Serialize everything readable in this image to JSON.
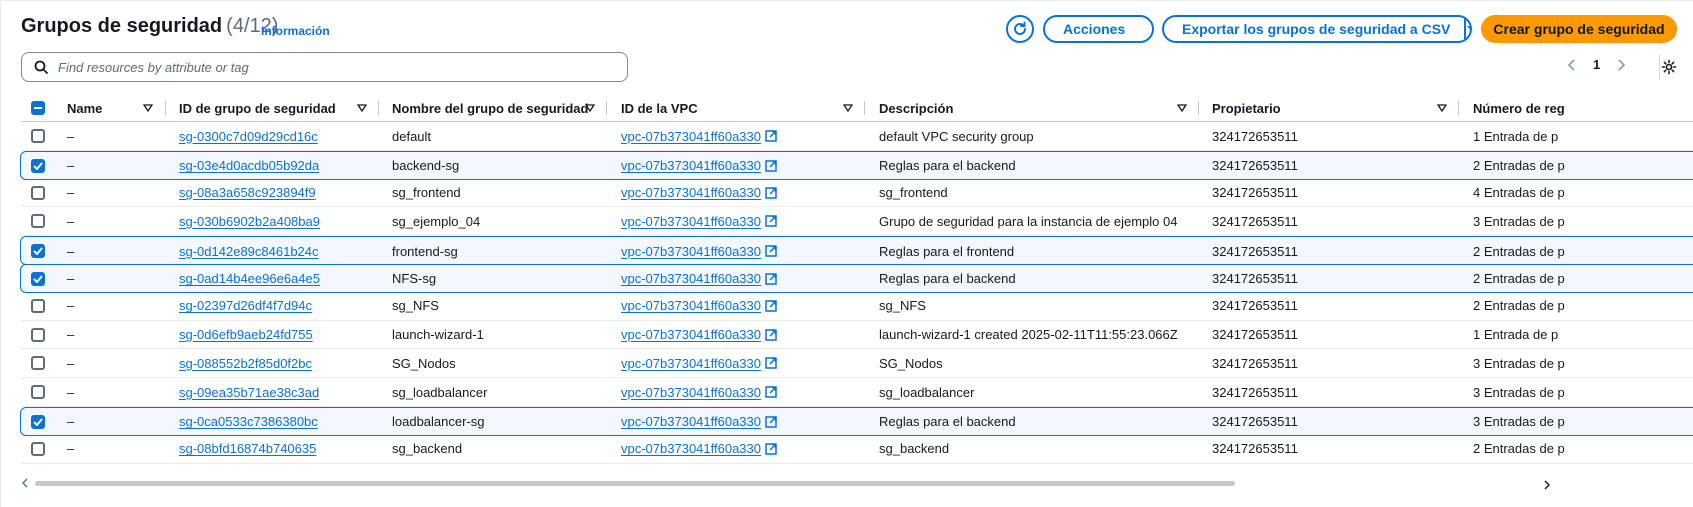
{
  "header": {
    "title": "Grupos de seguridad",
    "count": "(4/12)",
    "info_link": "Información",
    "actions_label": "Acciones",
    "export_label": "Exportar los grupos de seguridad a CSV",
    "create_label": "Crear grupo de seguridad"
  },
  "search": {
    "placeholder": "Find resources by attribute or tag",
    "value": ""
  },
  "pagination": {
    "current_page": "1"
  },
  "columns": [
    "Name",
    "ID de grupo de seguridad",
    "Nombre del grupo de seguridad",
    "ID de la VPC",
    "Descripción",
    "Propietario",
    "Número de reg"
  ],
  "rows": [
    {
      "selected": false,
      "name": "–",
      "sg_id": "sg-0300c7d09d29cd16c",
      "sg_name": "default",
      "vpc": "vpc-07b373041ff60a330",
      "desc": "default VPC security group",
      "owner": "324172653511",
      "rules": "1 Entrada de p"
    },
    {
      "selected": true,
      "name": "–",
      "sg_id": "sg-03e4d0acdb05b92da",
      "sg_name": "backend-sg",
      "vpc": "vpc-07b373041ff60a330",
      "desc": "Reglas para el backend",
      "owner": "324172653511",
      "rules": "2 Entradas de p"
    },
    {
      "selected": false,
      "name": "–",
      "sg_id": "sg-08a3a658c923894f9",
      "sg_name": "sg_frontend",
      "vpc": "vpc-07b373041ff60a330",
      "desc": "sg_frontend",
      "owner": "324172653511",
      "rules": "4 Entradas de p"
    },
    {
      "selected": false,
      "name": "–",
      "sg_id": "sg-030b6902b2a408ba9",
      "sg_name": "sg_ejemplo_04",
      "vpc": "vpc-07b373041ff60a330",
      "desc": "Grupo de seguridad para la instancia de ejemplo 04",
      "owner": "324172653511",
      "rules": "3 Entradas de p"
    },
    {
      "selected": true,
      "name": "–",
      "sg_id": "sg-0d142e89c8461b24c",
      "sg_name": "frontend-sg",
      "vpc": "vpc-07b373041ff60a330",
      "desc": "Reglas para el frontend",
      "owner": "324172653511",
      "rules": "2 Entradas de p"
    },
    {
      "selected": true,
      "name": "–",
      "sg_id": "sg-0ad14b4ee96e6a4e5",
      "sg_name": "NFS-sg",
      "vpc": "vpc-07b373041ff60a330",
      "desc": "Reglas para el backend",
      "owner": "324172653511",
      "rules": "2 Entradas de p"
    },
    {
      "selected": false,
      "name": "–",
      "sg_id": "sg-02397d26df4f7d94c",
      "sg_name": "sg_NFS",
      "vpc": "vpc-07b373041ff60a330",
      "desc": "sg_NFS",
      "owner": "324172653511",
      "rules": "2 Entradas de p"
    },
    {
      "selected": false,
      "name": "–",
      "sg_id": "sg-0d6efb9aeb24fd755",
      "sg_name": "launch-wizard-1",
      "vpc": "vpc-07b373041ff60a330",
      "desc": "launch-wizard-1 created 2025-02-11T11:55:23.066Z",
      "owner": "324172653511",
      "rules": "1 Entrada de p"
    },
    {
      "selected": false,
      "name": "–",
      "sg_id": "sg-088552b2f85d0f2bc",
      "sg_name": "SG_Nodos",
      "vpc": "vpc-07b373041ff60a330",
      "desc": "SG_Nodos",
      "owner": "324172653511",
      "rules": "3 Entradas de p"
    },
    {
      "selected": false,
      "name": "–",
      "sg_id": "sg-09ea35b71ae38c3ad",
      "sg_name": "sg_loadbalancer",
      "vpc": "vpc-07b373041ff60a330",
      "desc": "sg_loadbalancer",
      "owner": "324172653511",
      "rules": "3 Entradas de p"
    },
    {
      "selected": true,
      "name": "–",
      "sg_id": "sg-0ca0533c7386380bc",
      "sg_name": "loadbalancer-sg",
      "vpc": "vpc-07b373041ff60a330",
      "desc": "Reglas para el backend",
      "owner": "324172653511",
      "rules": "3 Entradas de p"
    },
    {
      "selected": false,
      "name": "–",
      "sg_id": "sg-08bfd16874b740635",
      "sg_name": "sg_backend",
      "vpc": "vpc-07b373041ff60a330",
      "desc": "sg_backend",
      "owner": "324172653511",
      "rules": "2 Entradas de p"
    }
  ],
  "icons": {
    "refresh": "refresh-icon",
    "search": "search-icon",
    "settings": "gear-icon",
    "external": "external-link-icon"
  },
  "colors": {
    "link": "#0972d3",
    "primary_button": "#ff9900",
    "selected_row": "#f2f8fd"
  }
}
